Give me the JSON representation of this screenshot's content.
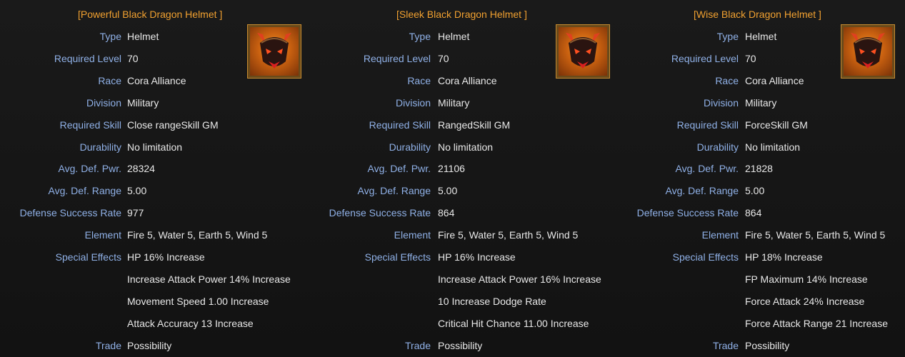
{
  "tooltips": [
    {
      "title": "[Powerful Black Dragon Helmet ]",
      "icon": "black-dragon-helmet-icon",
      "rows": [
        {
          "label": "Type",
          "value": "Helmet"
        },
        {
          "label": "Required Level",
          "value": "70"
        },
        {
          "label": "Race",
          "value": "Cora Alliance"
        },
        {
          "label": "Division",
          "value": "Military"
        },
        {
          "label": "Required Skill",
          "value": "Close rangeSkill GM"
        },
        {
          "label": "Durability",
          "value": "No limitation"
        },
        {
          "label": "Avg. Def. Pwr.",
          "value": "28324"
        },
        {
          "label": "Avg. Def. Range",
          "value": "5.00"
        },
        {
          "label": "Defense Success Rate",
          "value": "977"
        },
        {
          "label": "Element",
          "value": "Fire 5, Water 5, Earth 5, Wind 5"
        },
        {
          "label": "Special Effects",
          "value": "HP 16% Increase"
        },
        {
          "label": "",
          "value": "Increase Attack Power 14% Increase"
        },
        {
          "label": "",
          "value": "Movement Speed 1.00 Increase"
        },
        {
          "label": "",
          "value": "Attack Accuracy 13 Increase"
        },
        {
          "label": "Trade",
          "value": "Possibility"
        }
      ]
    },
    {
      "title": "[Sleek Black Dragon Helmet ]",
      "icon": "black-dragon-helmet-icon",
      "rows": [
        {
          "label": "Type",
          "value": "Helmet"
        },
        {
          "label": "Required Level",
          "value": "70"
        },
        {
          "label": "Race",
          "value": "Cora Alliance"
        },
        {
          "label": "Division",
          "value": "Military"
        },
        {
          "label": "Required Skill",
          "value": "RangedSkill GM"
        },
        {
          "label": "Durability",
          "value": "No limitation"
        },
        {
          "label": "Avg. Def. Pwr.",
          "value": "21106"
        },
        {
          "label": "Avg. Def. Range",
          "value": "5.00"
        },
        {
          "label": "Defense Success Rate",
          "value": "864"
        },
        {
          "label": "Element",
          "value": "Fire 5, Water 5, Earth 5, Wind 5"
        },
        {
          "label": "Special Effects",
          "value": "HP 16% Increase"
        },
        {
          "label": "",
          "value": "Increase Attack Power 16% Increase"
        },
        {
          "label": "",
          "value": "10 Increase Dodge Rate"
        },
        {
          "label": "",
          "value": "Critical Hit Chance 11.00 Increase"
        },
        {
          "label": "Trade",
          "value": "Possibility"
        }
      ]
    },
    {
      "title": "[Wise Black Dragon Helmet ]",
      "icon": "black-dragon-helmet-icon",
      "rows": [
        {
          "label": "Type",
          "value": "Helmet"
        },
        {
          "label": "Required Level",
          "value": "70"
        },
        {
          "label": "Race",
          "value": "Cora Alliance"
        },
        {
          "label": "Division",
          "value": "Military"
        },
        {
          "label": "Required Skill",
          "value": "ForceSkill GM"
        },
        {
          "label": "Durability",
          "value": "No limitation"
        },
        {
          "label": "Avg. Def. Pwr.",
          "value": "21828"
        },
        {
          "label": "Avg. Def. Range",
          "value": "5.00"
        },
        {
          "label": "Defense Success Rate",
          "value": "864"
        },
        {
          "label": "Element",
          "value": "Fire 5, Water 5, Earth 5, Wind 5"
        },
        {
          "label": "Special Effects",
          "value": "HP 18% Increase"
        },
        {
          "label": "",
          "value": "FP Maximum 14% Increase"
        },
        {
          "label": "",
          "value": "Force Attack 24% Increase"
        },
        {
          "label": "",
          "value": "Force Attack Range 21 Increase"
        },
        {
          "label": "Trade",
          "value": "Possibility"
        }
      ]
    }
  ],
  "colors": {
    "title": "#f0a030",
    "label": "#8fb0e6",
    "value": "#e8e8e8",
    "background": "#141414"
  }
}
